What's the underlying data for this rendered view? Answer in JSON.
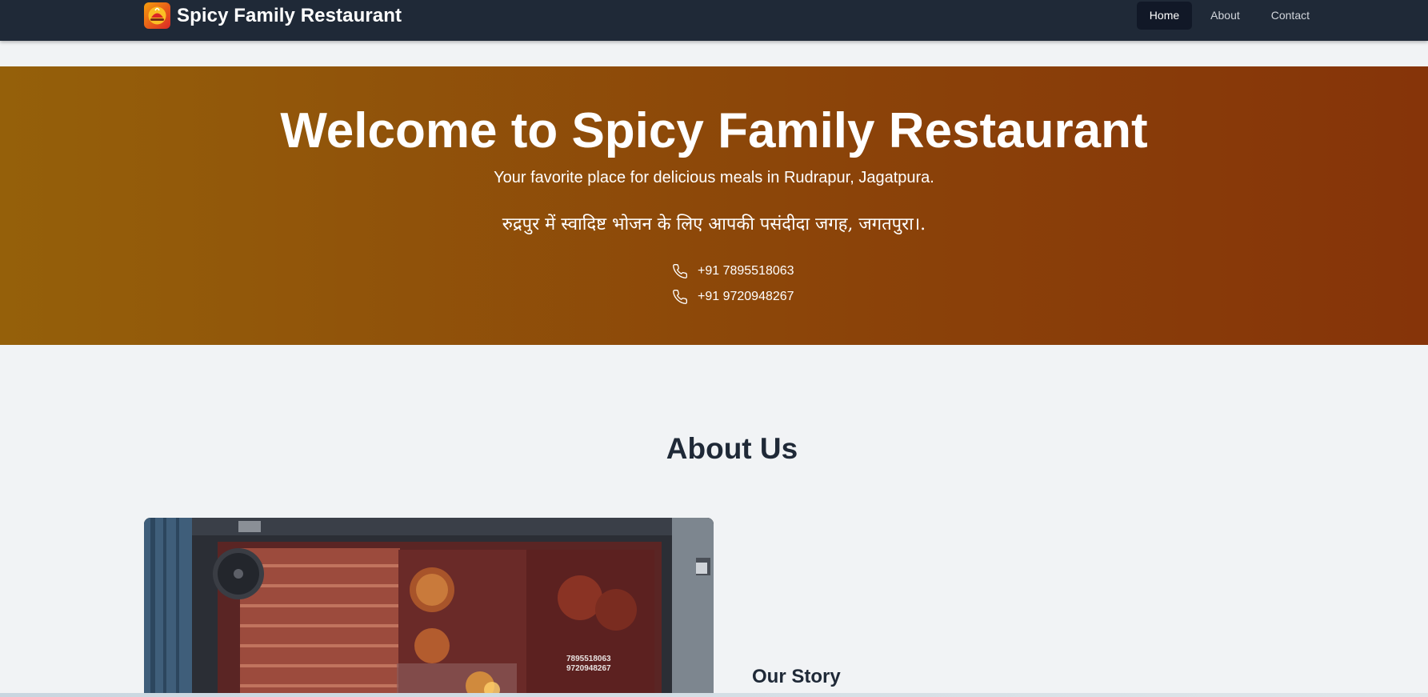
{
  "navbar": {
    "brand_name": "Spicy Family Restaurant",
    "logo_icon": "restaurant-logo",
    "links": [
      {
        "label": "Home",
        "active": true
      },
      {
        "label": "About",
        "active": false
      },
      {
        "label": "Contact",
        "active": false
      }
    ]
  },
  "hero": {
    "title": "Welcome to Spicy Family Restaurant",
    "subtitle": "Your favorite place for delicious meals in Rudrapur, Jagatpura.",
    "subtitle_hindi": "रुद्रपुर में स्वादिष्ट भोजन के लिए आपकी पसंदीदा जगह, जगतपुरा।.",
    "phones": [
      "+91 7895518063",
      "+91 9720948267"
    ],
    "phone_icon": "phone-icon"
  },
  "about": {
    "title": "About Us",
    "photo_phones": [
      "7895518063",
      "9720948267"
    ],
    "story_title": "Our Story"
  },
  "colors": {
    "navbar_bg": "#1f2937",
    "hero_gradient_start": "#95600a",
    "hero_gradient_end": "#863409",
    "page_bg": "#f1f3f5",
    "heading_text": "#1f2937"
  }
}
